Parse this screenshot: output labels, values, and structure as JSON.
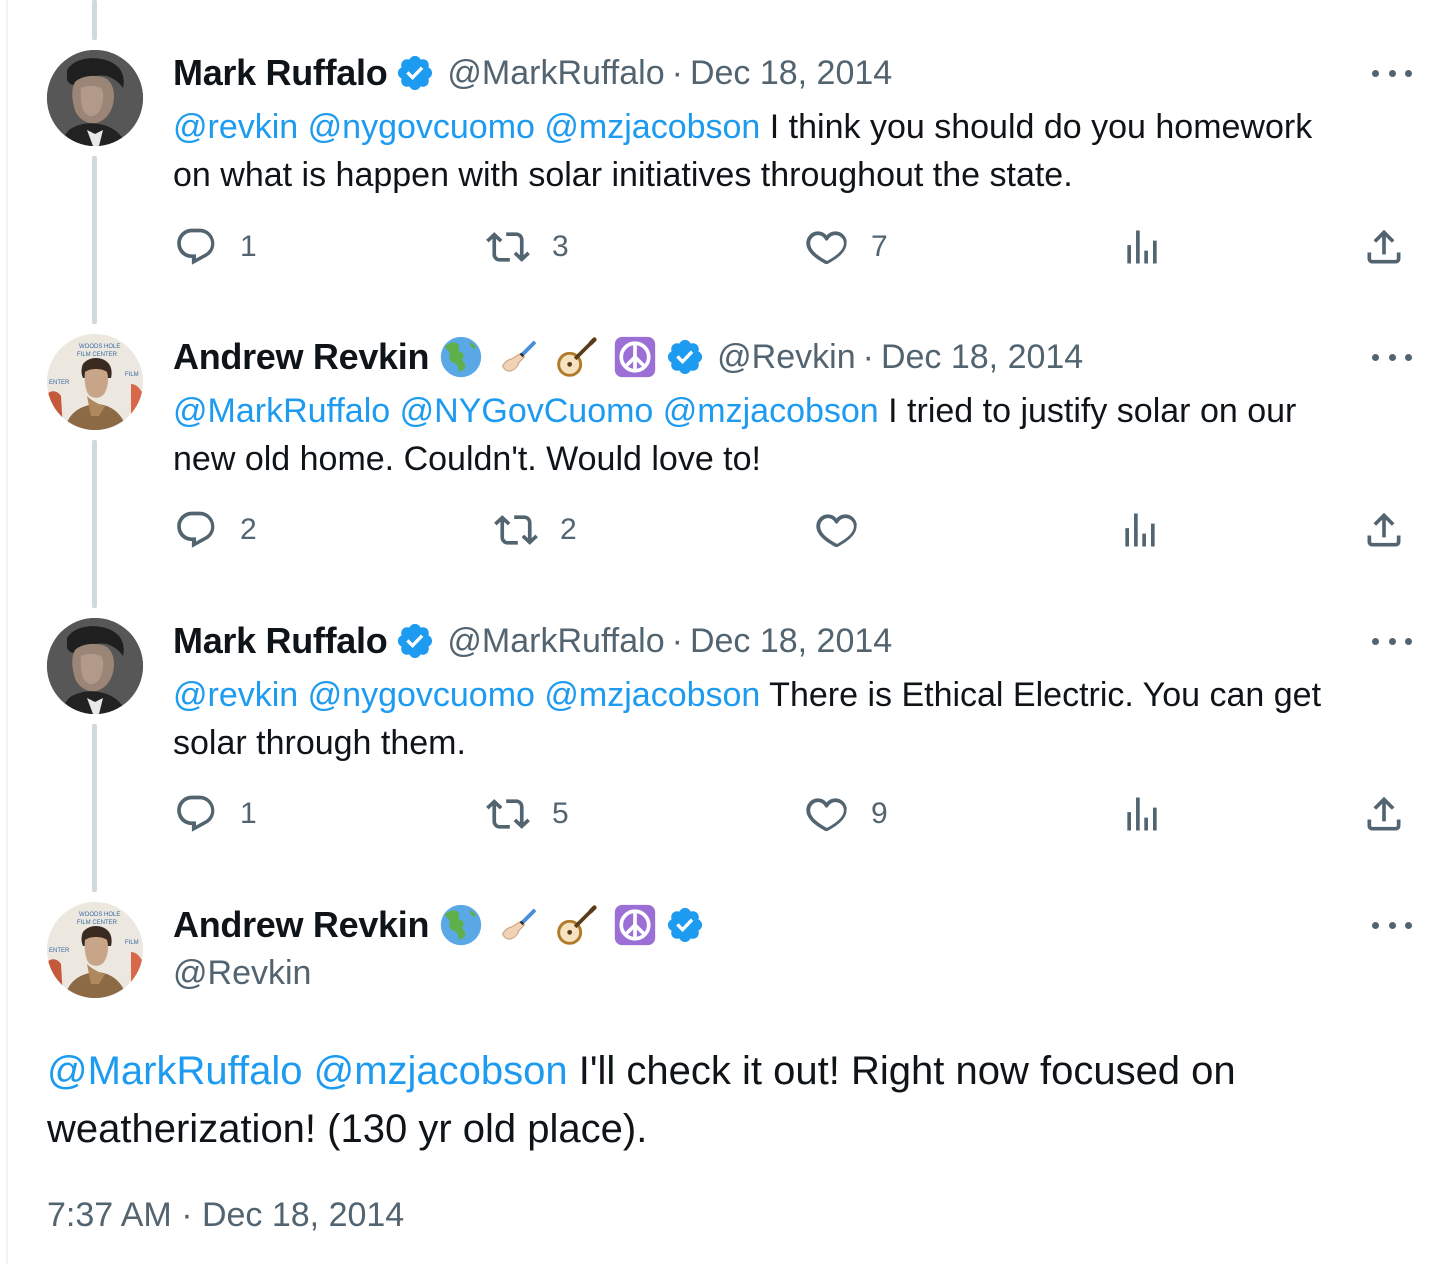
{
  "tweets": [
    {
      "name": "Mark Ruffalo",
      "handle": "@MarkRuffalo",
      "date": "Dec 18, 2014",
      "mentions": "@revkin @nygovcuomo @mzjacobson",
      "text_line1": " I think you should do you homework",
      "text_line2": "on what is happen with solar initiatives throughout the state.",
      "replies": "1",
      "retweets": "3",
      "likes": "7"
    },
    {
      "name": "Andrew Revkin",
      "handle": "@Revkin",
      "date": "Dec 18, 2014",
      "mentions": "@MarkRuffalo @NYGovCuomo @mzjacobson",
      "text_line1": " I tried to justify solar on our",
      "text_line2": "new old home. Couldn't. Would love to!",
      "replies": "2",
      "retweets": "2",
      "likes": ""
    },
    {
      "name": "Mark Ruffalo",
      "handle": "@MarkRuffalo",
      "date": "Dec 18, 2014",
      "mentions": "@revkin @nygovcuomo @mzjacobson",
      "text_line1": " There is Ethical Electric. You can get",
      "text_line2": "solar through them.",
      "replies": "1",
      "retweets": "5",
      "likes": "9"
    }
  ],
  "main_tweet": {
    "name": "Andrew Revkin",
    "handle": "@Revkin",
    "mentions": "@MarkRuffalo @mzjacobson",
    "text_line1": " I'll check it out! Right now focused on",
    "text_line2": "weatherization! (130 yr old place).",
    "timestamp": "7:37 AM · Dec 18, 2014"
  },
  "separator": "·",
  "icons": [
    "verified-badge-icon",
    "globe-americas-icon",
    "writing-hand-icon",
    "banjo-icon",
    "peace-symbol-icon",
    "more-icon",
    "reply-icon",
    "retweet-icon",
    "like-icon",
    "views-icon",
    "share-icon"
  ],
  "colors": {
    "link": "#1d9bf0",
    "secondary": "#536471",
    "text": "#0f1419",
    "thread_line": "#cfd9de",
    "verified": "#1d9bf0"
  }
}
